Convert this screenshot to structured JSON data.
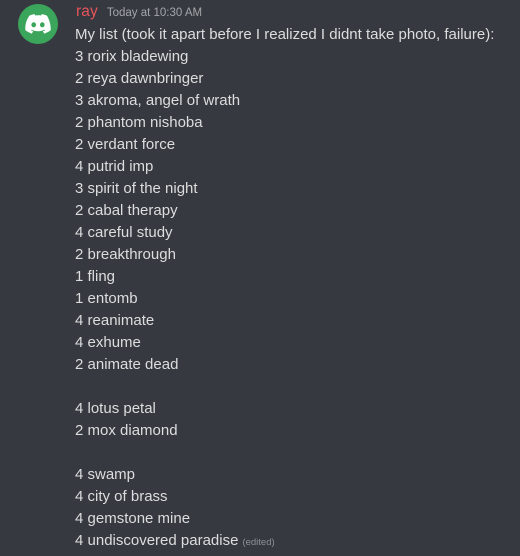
{
  "colors": {
    "background": "#36393f",
    "avatar_bg": "#3ba55c",
    "username": "#e8545b",
    "text": "#dcddde",
    "timestamp": "#a3a6aa",
    "edited": "#8e9297"
  },
  "message": {
    "avatar_icon": "discord-logo-icon",
    "username": "ray",
    "timestamp": "Today at 10:30 AM",
    "intro": "My list (took it apart before I realized I didnt take photo, failure):",
    "lines": [
      "3 rorix bladewing",
      "2 reya dawnbringer",
      "3 akroma, angel of wrath",
      "2 phantom nishoba",
      "2 verdant force",
      "4 putrid imp",
      "3 spirit of the night",
      "2 cabal therapy",
      "4 careful study",
      "2 breakthrough",
      "1 fling",
      "1 entomb",
      "4 reanimate",
      "4 exhume",
      "2 animate dead",
      "",
      "4 lotus petal",
      "2 mox diamond",
      "",
      "4 swamp",
      "4 city of brass",
      "4 gemstone mine",
      "4 undiscovered paradise"
    ],
    "edited_label": "(edited)"
  }
}
